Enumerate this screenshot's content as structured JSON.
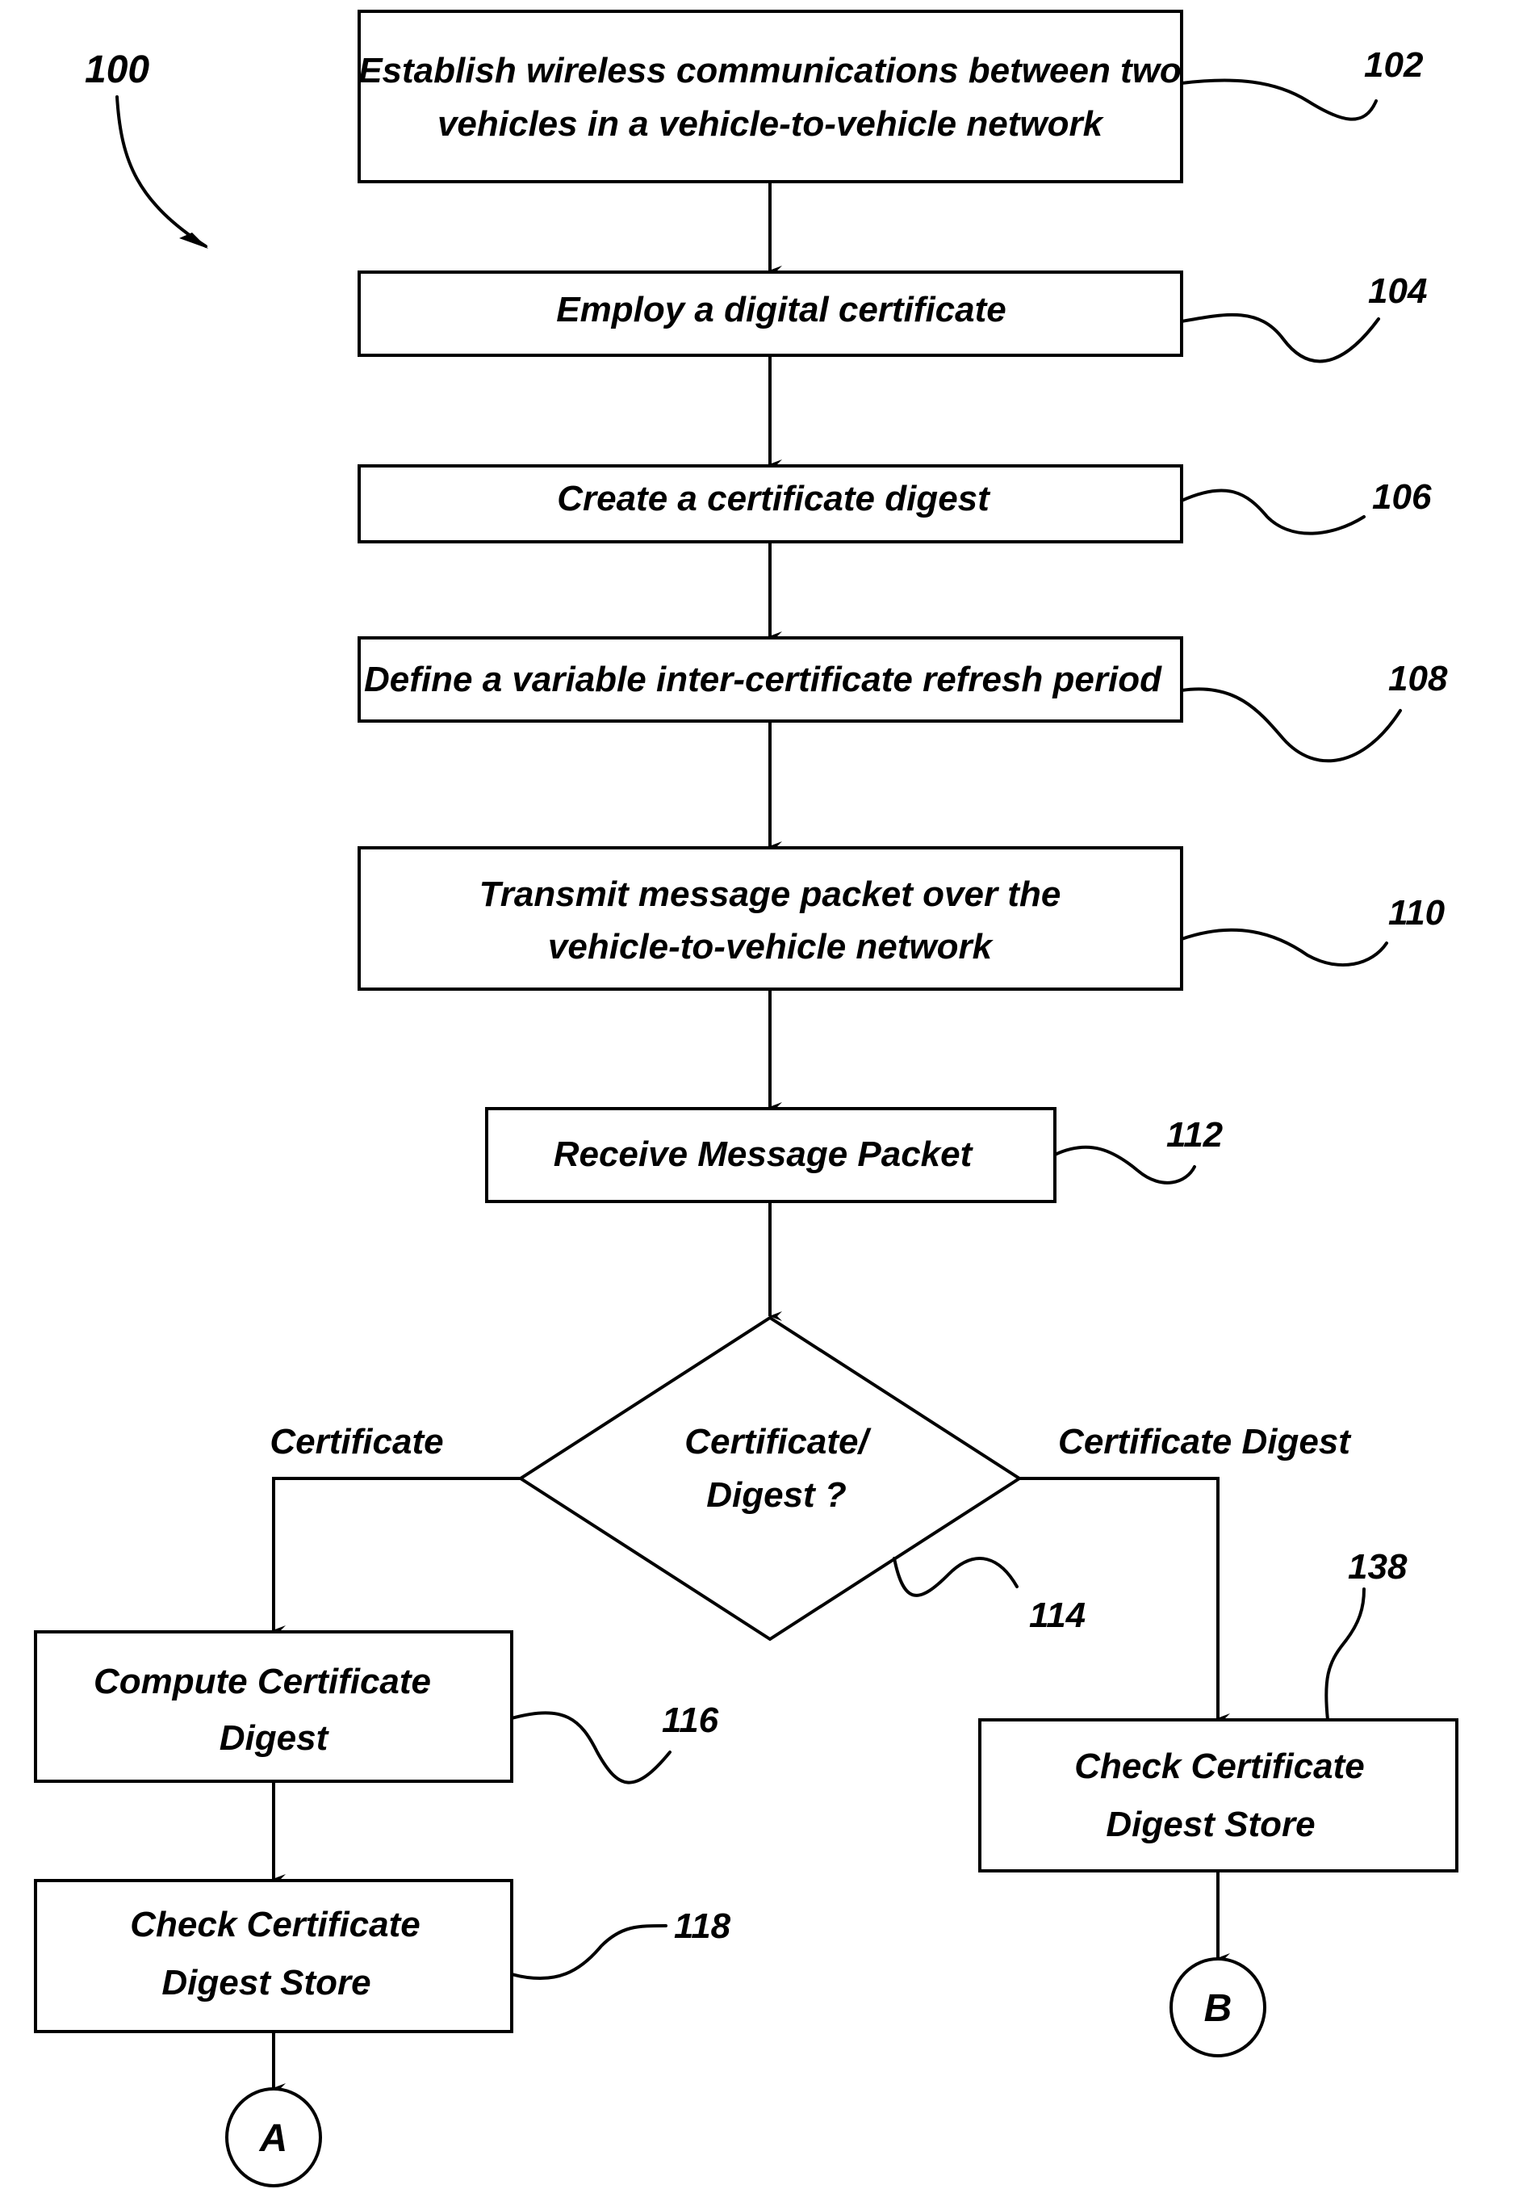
{
  "figure": {
    "reference": "100",
    "steps": [
      {
        "id": "102",
        "lines": [
          "Establish wireless communications between two",
          "vehicles in a vehicle-to-vehicle network"
        ]
      },
      {
        "id": "104",
        "lines": [
          "Employ a digital certificate"
        ]
      },
      {
        "id": "106",
        "lines": [
          "Create a certificate digest"
        ]
      },
      {
        "id": "108",
        "lines": [
          "Define a variable inter-certificate refresh period"
        ]
      },
      {
        "id": "110",
        "lines": [
          "Transmit message packet over the",
          "vehicle-to-vehicle network"
        ]
      },
      {
        "id": "112",
        "lines": [
          "Receive Message Packet"
        ]
      },
      {
        "id": "116",
        "lines": [
          "Compute Certificate",
          "Digest"
        ]
      },
      {
        "id": "118",
        "lines": [
          "Check Certificate",
          "Digest Store"
        ]
      },
      {
        "id": "138",
        "lines": [
          "Check Certificate",
          "Digest Store"
        ]
      }
    ],
    "decision": {
      "id": "114",
      "lines": [
        "Certificate/",
        "Digest ?"
      ]
    },
    "branches": {
      "left": "Certificate",
      "right": "Certificate Digest"
    },
    "connectors": {
      "left": "A",
      "right": "B"
    }
  }
}
